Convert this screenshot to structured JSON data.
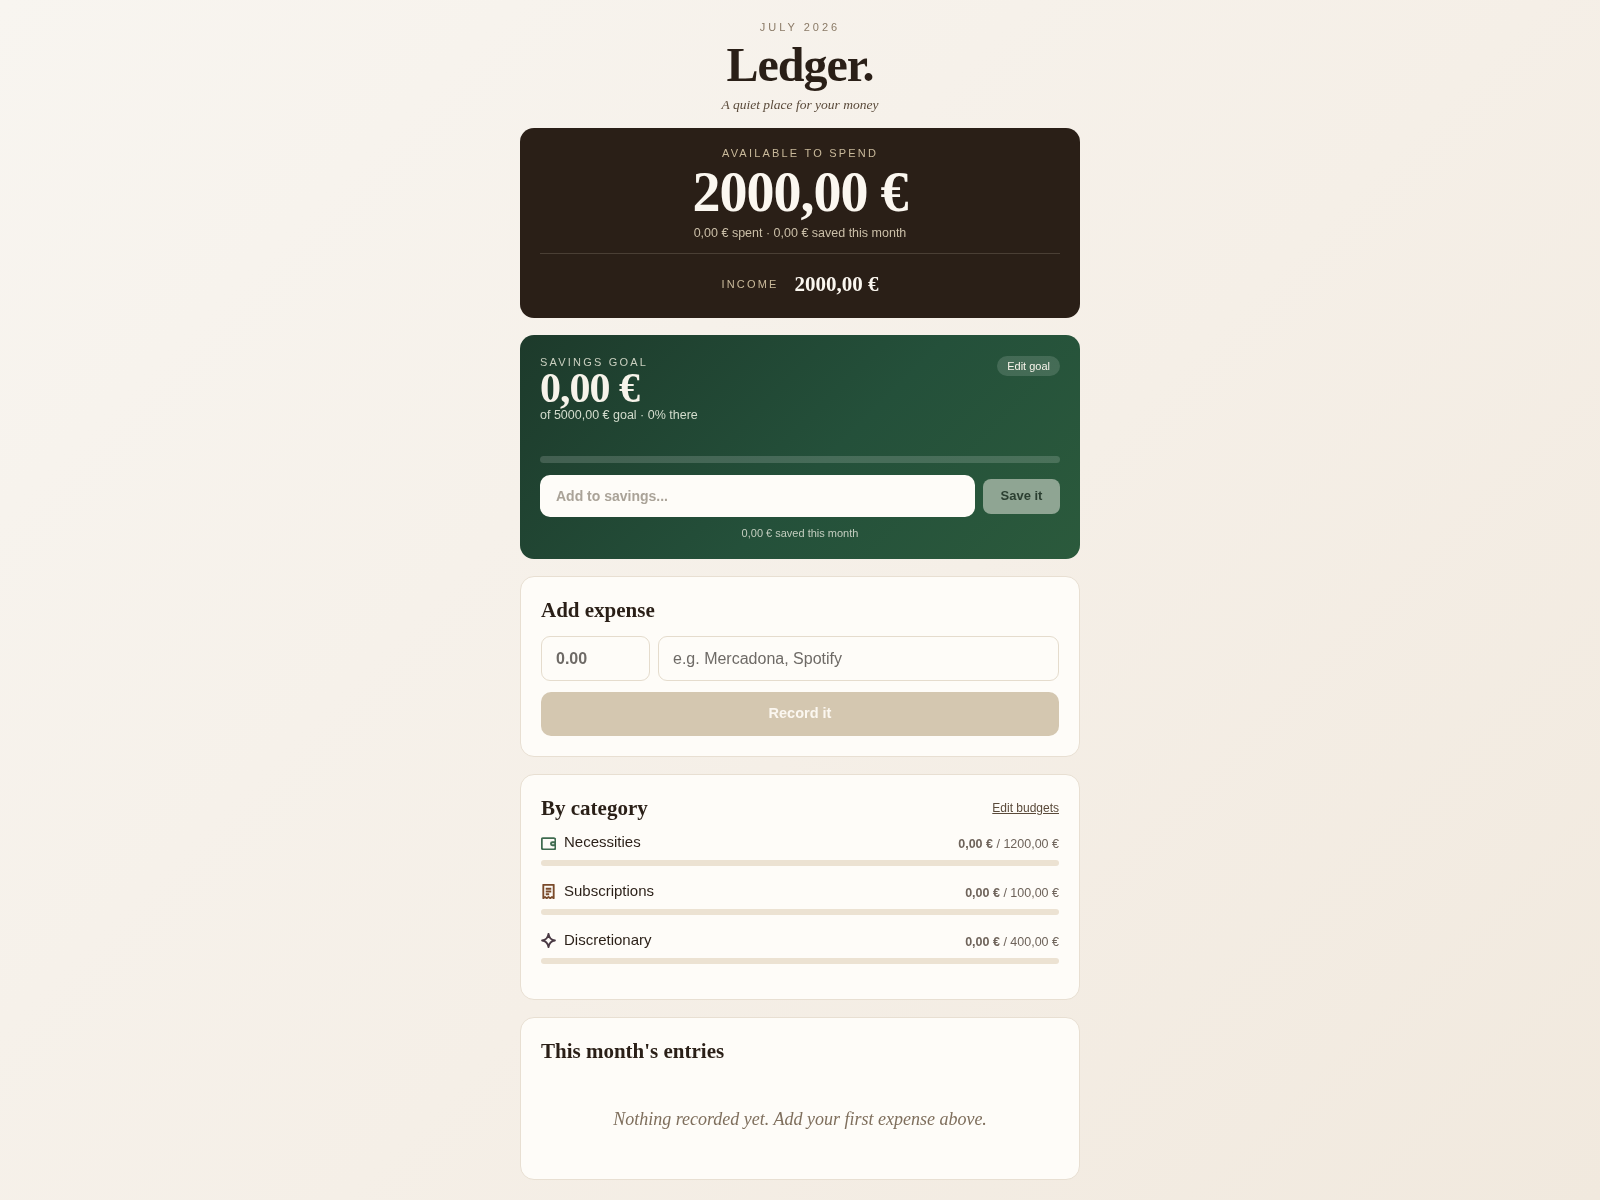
{
  "header": {
    "month": "JULY 2026",
    "title": "Ledger.",
    "tagline": "A quiet place for your money"
  },
  "available": {
    "label": "AVAILABLE TO SPEND",
    "amount": "2000,00 €",
    "summary": "0,00 € spent · 0,00 € saved this month",
    "income_label": "INCOME",
    "income": "2000,00 €"
  },
  "savings": {
    "label": "SAVINGS GOAL",
    "amount": "0,00 €",
    "summary": "of 5000,00 € goal · 0% there",
    "edit_button": {
      "label": "Edit goal"
    },
    "level": 0,
    "input": {
      "placeholder": "Add to savings..."
    },
    "save_button": {
      "label": "Save it",
      "disabled": true
    },
    "caption": "0,00 € saved this month"
  },
  "add_expense": {
    "title": "Add expense",
    "amount_field": {
      "placeholder": "0.00"
    },
    "description_field": {
      "placeholder": "e.g. Mercadona, Spotify"
    },
    "record_button": {
      "label": "Record it",
      "disabled": true
    }
  },
  "categories": {
    "title": "By category",
    "edit_link": "Edit budgets",
    "items": [
      {
        "name": "Necessities",
        "color": "#3f6b4f",
        "amounts": "**0,00 €** / 1200,00 €",
        "level": 0
      },
      {
        "name": "Subscriptions",
        "color": "#7a4a2a",
        "amounts": "**0,00 €** / 100,00 €",
        "level": 0
      },
      {
        "name": "Discretionary",
        "color": "#4a3a44",
        "amounts": "**0,00 €** / 400,00 €",
        "level": 0
      }
    ]
  },
  "entries": {
    "title": "This month's entries",
    "empty_message": "Nothing recorded yet. Add your first expense above."
  }
}
